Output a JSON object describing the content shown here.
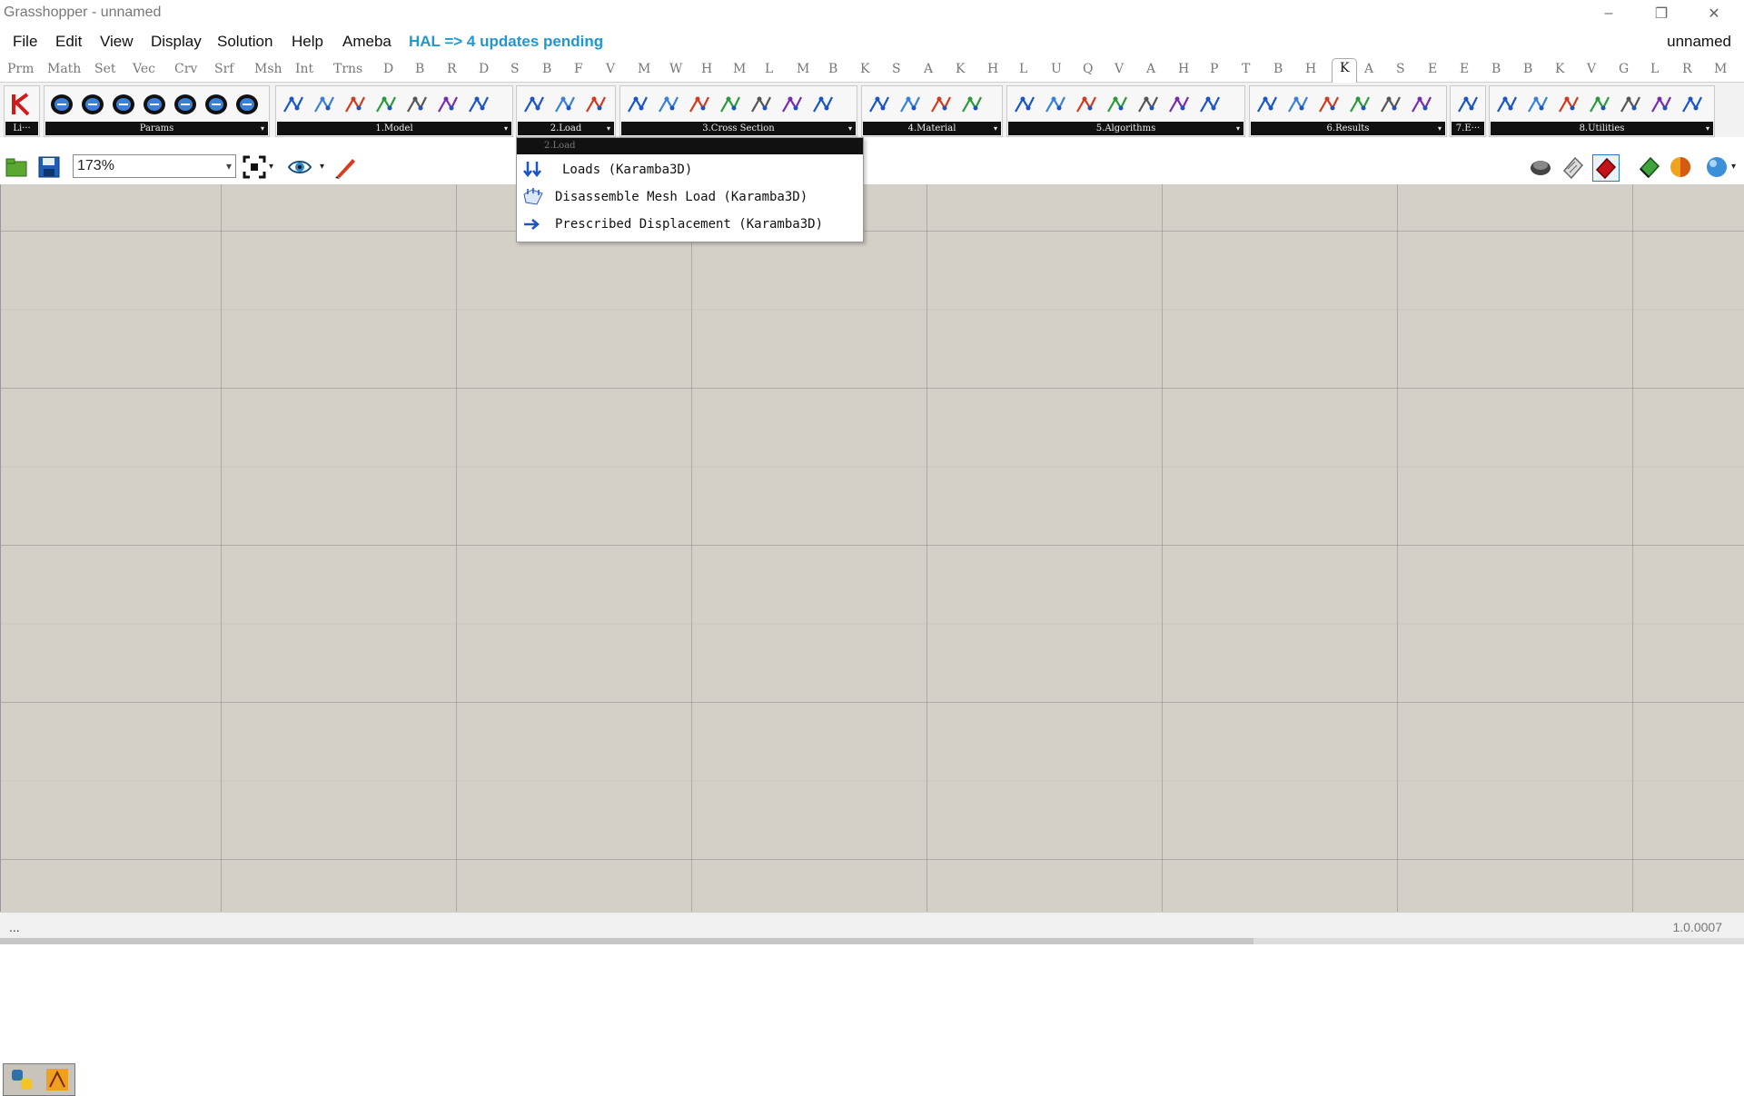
{
  "window": {
    "title": "Grasshopper - unnamed",
    "controls": {
      "minimize": "–",
      "restore": "❐",
      "close": "✕"
    }
  },
  "menubar": {
    "items": [
      "File",
      "Edit",
      "View",
      "Display",
      "Solution",
      "Help",
      "Ameba"
    ],
    "hal_notice": "HAL => 4 updates pending",
    "document_name": "unnamed"
  },
  "tabs": {
    "items": [
      "Prm",
      "Math",
      "Set",
      "Vec",
      "Crv",
      "Srf",
      "Msh",
      "Int",
      "Trns",
      "D",
      "B",
      "R",
      "D",
      "S",
      "B",
      "F",
      "V",
      "M",
      "W",
      "H",
      "M",
      "L",
      "M",
      "B",
      "K",
      "S",
      "A",
      "K",
      "H",
      "L",
      "U",
      "Q",
      "V",
      "A",
      "H",
      "P",
      "T",
      "B",
      "H",
      "K",
      "A",
      "S",
      "E",
      "E",
      "B",
      "B",
      "K",
      "V",
      "G",
      "L",
      "R",
      "M"
    ],
    "active_index": 39
  },
  "ribbon": {
    "panels": [
      {
        "label": "Li···",
        "icons": [
          "karamba-logo-icon"
        ]
      },
      {
        "label": "Params",
        "icons": [
          "param-model-icon",
          "param-beam-icon",
          "param-shell-icon",
          "param-element-icon",
          "param-load-icon",
          "param-cross-section-icon",
          "param-material-icon"
        ]
      },
      {
        "label": "1.Model",
        "icons": [
          "line-to-beam-icon",
          "connectivity-icon",
          "mesh-to-shell-icon",
          "index-to-element-icon",
          "support-icon",
          "assemble-icon",
          "modify-icon"
        ]
      },
      {
        "label": "2.Load",
        "icons": [
          "loads-icon",
          "mesh-load-icon",
          "prescribed-displacement-icon"
        ]
      },
      {
        "label": "3.Cross Section",
        "icons": [
          "cross-section-icon",
          "cross-section-range-icon",
          "cross-section-selector-icon",
          "beam-joint-icon",
          "eccentricity-icon",
          "cross-section-matcher-icon",
          "disassemble-cs-icon"
        ]
      },
      {
        "label": "4.Material",
        "icons": [
          "material-properties-icon",
          "material-selection-icon",
          "read-material-icon",
          "disassemble-material-icon"
        ]
      },
      {
        "label": "5.Algorithms",
        "icons": [
          "analyze-th-i-icon",
          "analyze-th-ii-icon",
          "analyze-nonlinear-icon",
          "large-deformation-icon",
          "buckling-icon",
          "eigen-modes-icon",
          "natural-vibrations-icon"
        ]
      },
      {
        "label": "6.Results",
        "icons": [
          "model-view-icon",
          "shell-view-icon",
          "beam-view-icon",
          "reaction-forces-icon",
          "deformation-energy-icon",
          "utilization-icon"
        ]
      },
      {
        "label": "7.E···",
        "icons": [
          "export-icon"
        ]
      },
      {
        "label": "8.Utilities",
        "icons": [
          "mesh-breps-icon",
          "line-line-intersection-icon",
          "nearest-neighbor-icon",
          "remove-duplicate-lines-icon",
          "detect-collisions-icon",
          "element-felting-icon",
          "line-mesh-intersection-icon"
        ]
      }
    ]
  },
  "canvas_toolbar": {
    "zoom": "173%",
    "icons": [
      "open-file-icon",
      "save-file-icon",
      "zoom-extents-icon",
      "preview-eye-icon",
      "sketch-pen-icon"
    ],
    "right_icons": [
      "preview-wireframe-icon",
      "preview-no-shading-icon",
      "preview-shaded-icon",
      "preview-selected-icon",
      "preview-material-icon",
      "render-sphere-icon"
    ]
  },
  "dropdown": {
    "header": "2.Load",
    "items": [
      {
        "label": "Loads (Karamba3D)",
        "icon": "loads-icon"
      },
      {
        "label": "Disassemble Mesh Load (Karamba3D)",
        "icon": "mesh-load-icon"
      },
      {
        "label": "Prescribed Displacement (Karamba3D)",
        "icon": "prescribed-displacement-icon"
      }
    ]
  },
  "canvas": {
    "bottom_icons": [
      "python-icon",
      "ladybug-icon"
    ]
  },
  "statusbar": {
    "left": "...",
    "version": "1.0.0007"
  },
  "colors": {
    "canvas": "#d4d0c8",
    "hal": "#1f97d4",
    "label_band": "#111111"
  }
}
